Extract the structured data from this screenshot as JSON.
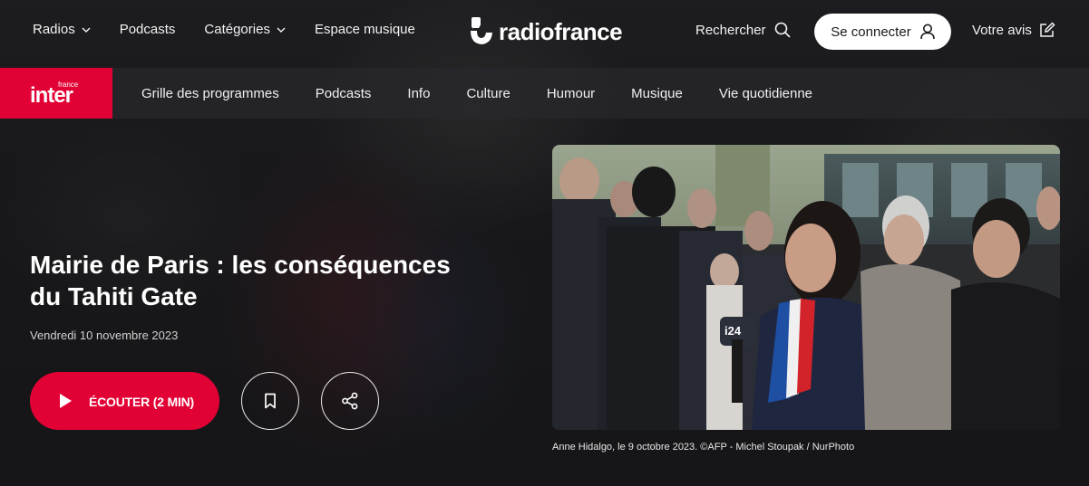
{
  "header": {
    "nav": [
      {
        "label": "Radios",
        "has_dropdown": true
      },
      {
        "label": "Podcasts",
        "has_dropdown": false
      },
      {
        "label": "Catégories",
        "has_dropdown": true
      },
      {
        "label": "Espace musique",
        "has_dropdown": false
      }
    ],
    "logo_text": "radiofrance",
    "search_label": "Rechercher",
    "login_label": "Se connecter",
    "feedback_label": "Votre avis"
  },
  "station": {
    "logo_small": "france",
    "logo_big": "inter",
    "accent": "#e20134",
    "nav": [
      "Grille des programmes",
      "Podcasts",
      "Info",
      "Culture",
      "Humour",
      "Musique",
      "Vie quotidienne"
    ]
  },
  "article": {
    "title": "Mairie de Paris : les conséquences du Tahiti Gate",
    "date": "Vendredi 10 novembre 2023",
    "listen_label": "ÉCOUTER (2 MIN)"
  },
  "photo": {
    "caption": "Anne Hidalgo, le 9 octobre 2023. ©AFP - Michel Stoupak / NurPhoto",
    "mic_label": "i24"
  },
  "icons": {
    "search": "search-icon",
    "user": "user-icon",
    "feedback": "edit-icon",
    "play": "play-icon",
    "bookmark": "bookmark-icon",
    "share": "share-icon"
  }
}
